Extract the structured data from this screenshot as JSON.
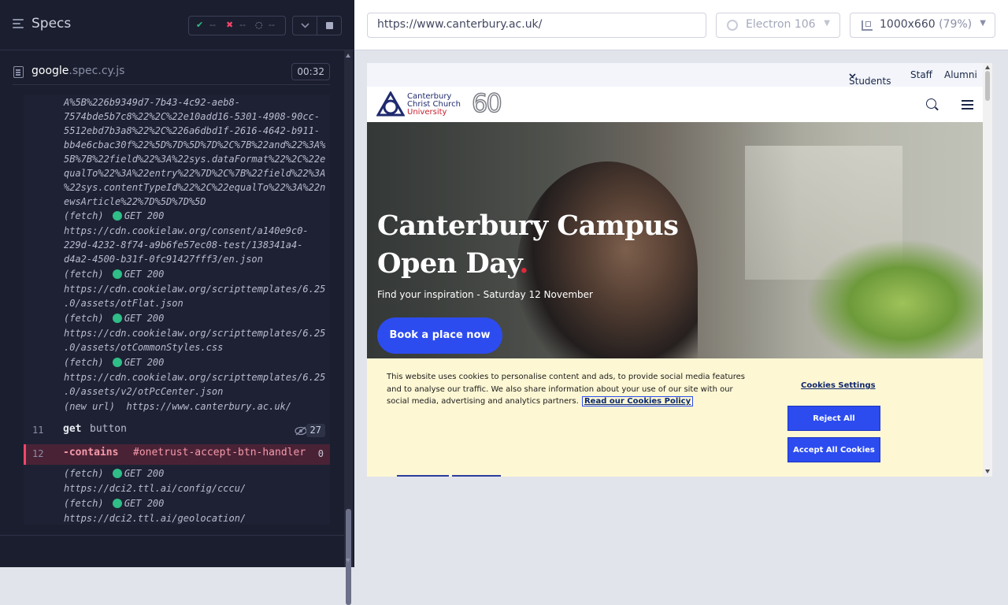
{
  "runner": {
    "title": "Specs",
    "stats": {
      "passed": "--",
      "failed": "--",
      "pending": "--"
    },
    "file": {
      "name": "google",
      "ext": ".spec.cy.js",
      "duration": "00:32"
    },
    "log_top": [
      "A%5B%226b9349d7-7b43-4c92-aeb8-",
      "7574bde5b7c8%22%2C%22e10add16-5301-4908-90cc-",
      "5512ebd7b3a8%22%2C%226a6dbd1f-2616-4642-b911-",
      "bb4e6cbac30f%22%5D%7D%5D%7D%2C%7B%22and%22%3A%",
      "5B%7B%22field%22%3A%22sys.dataFormat%22%2C%22e",
      "qualTo%22%3A%22entry%22%7D%2C%7B%22field%22%3A",
      "%22sys.contentTypeId%22%2C%22equalTo%22%3A%22n",
      "ewsArticle%22%7D%5D%7D%5D"
    ],
    "fetches_top": [
      {
        "label": "(fetch)",
        "status": "GET 200",
        "url": [
          "https://cdn.cookielaw.org/consent/a140e9c0-",
          "229d-4232-8f74-a9b6fe57ec08-test/138341a4-",
          "d4a2-4500-b31f-0fc91427fff3/en.json"
        ]
      },
      {
        "label": "(fetch)",
        "status": "GET 200",
        "url": [
          "https://cdn.cookielaw.org/scripttemplates/6.25",
          ".0/assets/otFlat.json"
        ]
      },
      {
        "label": "(fetch)",
        "status": "GET 200",
        "url": [
          "https://cdn.cookielaw.org/scripttemplates/6.25",
          ".0/assets/otCommonStyles.css"
        ]
      },
      {
        "label": "(fetch)",
        "status": "GET 200",
        "url": [
          "https://cdn.cookielaw.org/scripttemplates/6.25",
          ".0/assets/v2/otPcCenter.json"
        ]
      }
    ],
    "new_url": {
      "label": "(new url)",
      "url": "https://www.canterbury.ac.uk/"
    },
    "commands": [
      {
        "num": "11",
        "name": "get",
        "message": "button",
        "count": "27"
      },
      {
        "num": "12",
        "name": "-contains",
        "message": "#onetrust-accept-btn-handler",
        "count": "0"
      }
    ],
    "fetches_bottom": [
      {
        "label": "(fetch)",
        "status": "GET 200",
        "url": "https://dci2.ttl.ai/config/cccu/"
      },
      {
        "label": "(fetch)",
        "status": "GET 200",
        "url": "https://dci2.ttl.ai/geolocation/"
      }
    ]
  },
  "aut": {
    "url": "https://www.canterbury.ac.uk/",
    "browser": "Electron 106",
    "viewport": "1000x660",
    "scale": "(79%)"
  },
  "site": {
    "topnav": {
      "students": "Students",
      "staff": "Staff",
      "alumni": "Alumni"
    },
    "logo": {
      "line1": "Canterbury",
      "line2": "Christ Church",
      "line3": "University",
      "anniversary": "60"
    },
    "hero": {
      "title_line1": "Canterbury Campus",
      "title_line2": "Open Day",
      "title_dot": ".",
      "subtitle": "Find your inspiration - Saturday 12 November",
      "button": "Book a place now"
    },
    "cookie": {
      "text": "This website uses cookies to personalise content and ads, to provide social media features and to analyse our traffic. We also share information about your use of our site with our social media, advertising and analytics partners.",
      "link": "Read our Cookies Policy",
      "settings": "Cookies Settings",
      "reject": "Reject All",
      "accept": "Accept All Cookies"
    }
  }
}
